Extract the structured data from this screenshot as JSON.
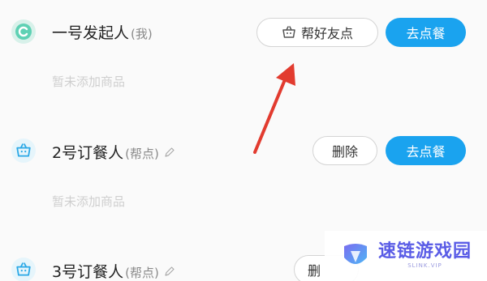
{
  "rows": [
    {
      "name": "一号发起人",
      "tag": "(我)",
      "empty_text": "暂未添加商品",
      "help_label": "帮好友点",
      "order_label": "去点餐"
    },
    {
      "name": "2号订餐人",
      "tag": "(帮点)",
      "empty_text": "暂未添加商品",
      "delete_label": "删除",
      "order_label": "去点餐"
    },
    {
      "name": "3号订餐人",
      "tag": "(帮点)",
      "delete_label_partial": "删"
    }
  ],
  "watermark": {
    "title": "速链游戏园",
    "subtitle": "SLINK.VIP"
  },
  "colors": {
    "primary_button": "#1aa3ef",
    "arrow": "#e23b2f",
    "empty_text": "#cfcfcf"
  }
}
